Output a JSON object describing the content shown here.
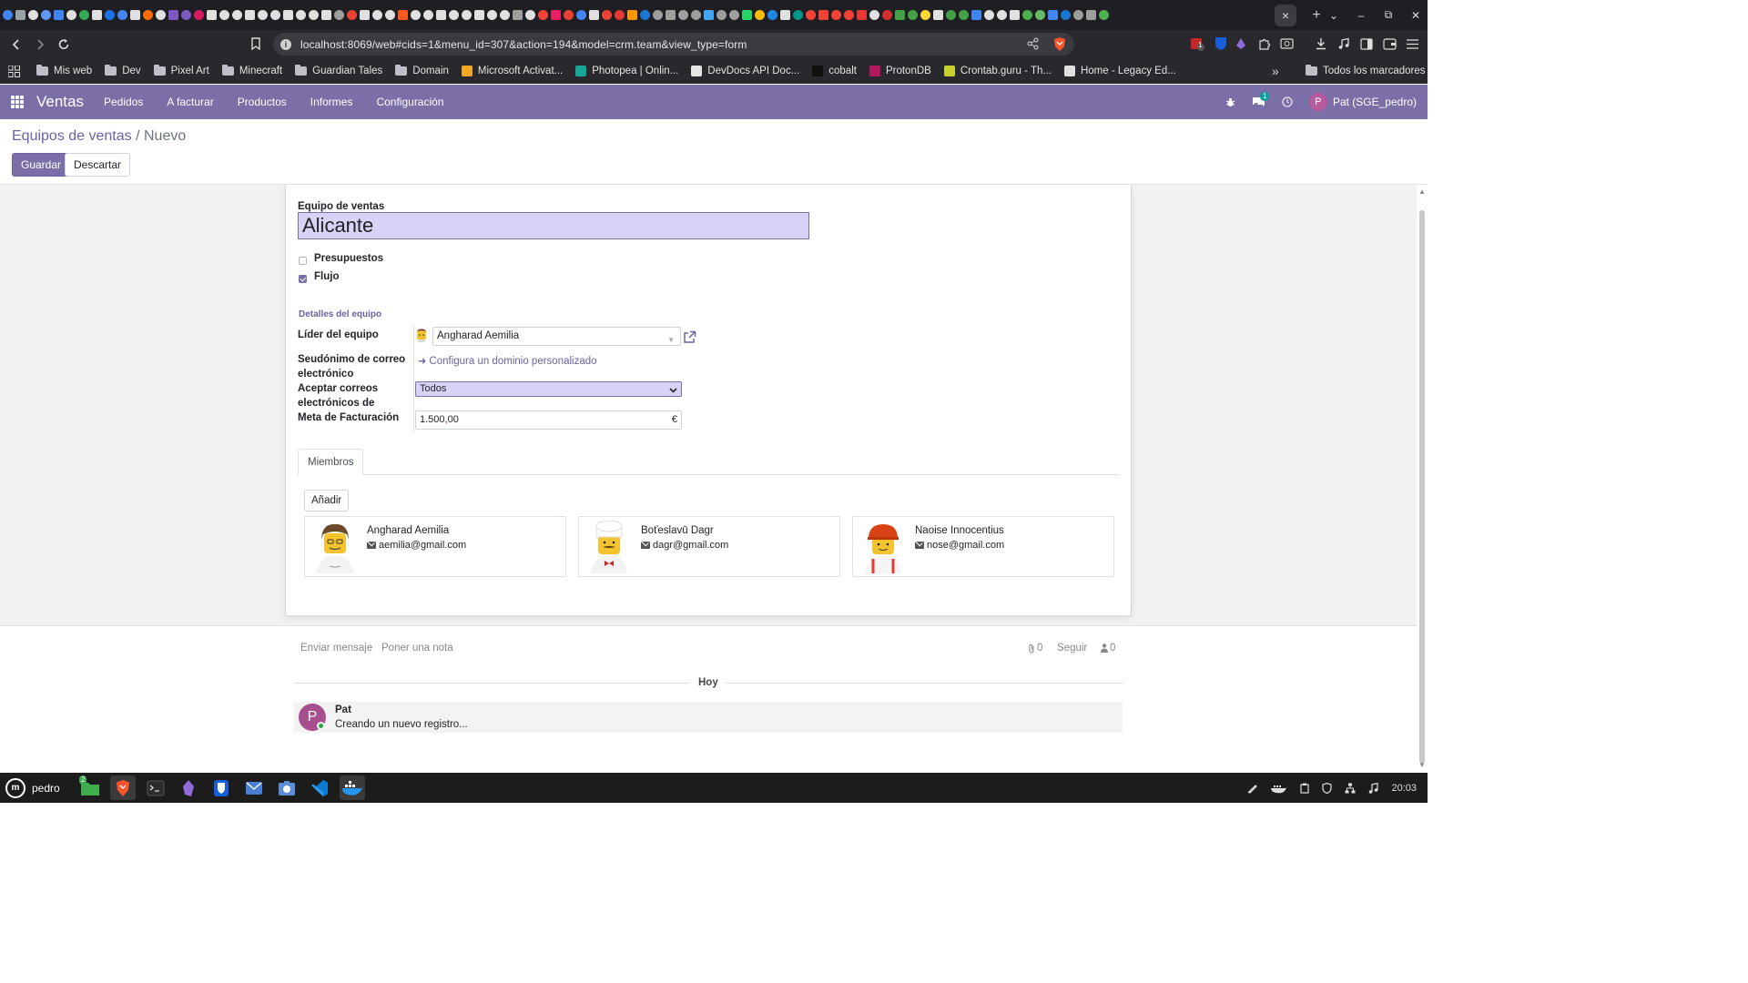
{
  "browser": {
    "url": "localhost:8069/web#cids=1&menu_id=307&action=194&model=crm.team&view_type=form",
    "close_tab_glyph": "×",
    "new_tab_glyph": "+",
    "tab_favicon_colors": [
      "#4285f4",
      "#9aa0a6",
      "#e0e0e0",
      "#5e97f6",
      "#4285f4",
      "#e0e0e0",
      "#34a853",
      "#e0e0e0",
      "#1a73e8",
      "#4285f4",
      "#e0e0e0",
      "#ff6d00",
      "#e0e0e0",
      "#7e57c2",
      "#7e57c2",
      "#d81b60",
      "#e0e0e0",
      "#e0e0e0",
      "#e0e0e0",
      "#e0e0e0",
      "#e0e0e0",
      "#e0e0e0",
      "#e0e0e0",
      "#e0e0e0",
      "#e0e0e0",
      "#e0e0e0",
      "#9e9e9e",
      "#ea4335",
      "#e0e0e0",
      "#e0e0e0",
      "#e0e0e0",
      "#ff5722",
      "#e0e0e0",
      "#e0e0e0",
      "#e0e0e0",
      "#e0e0e0",
      "#e0e0e0",
      "#e0e0e0",
      "#e0e0e0",
      "#e0e0e0",
      "#9e9e9e",
      "#e0e0e0",
      "#f44336",
      "#e91e63",
      "#ea4335",
      "#4285f4",
      "#e0e0e0",
      "#ea4335",
      "#e53935",
      "#ff9800",
      "#1976d2",
      "#9e9e9e",
      "#9e9e9e",
      "#9e9e9e",
      "#9e9e9e",
      "#42a5f5",
      "#9e9e9e",
      "#9e9e9e",
      "#25d366",
      "#fbbc04",
      "#1e88e5",
      "#e0e0e0",
      "#009688",
      "#f44336",
      "#f44336",
      "#f44336",
      "#f44336",
      "#e53935",
      "#e0e0e0",
      "#d32f2f",
      "#43a047",
      "#43a047",
      "#fdd835",
      "#e0e0e0",
      "#43a047",
      "#43a047",
      "#4285f4",
      "#e0e0e0",
      "#e0e0e0",
      "#e0e0e0",
      "#4caf50",
      "#66bb6a",
      "#4285f4",
      "#1976d2",
      "#9e9e9e",
      "#9e9e9e",
      "#4caf50"
    ],
    "bookmarks": [
      {
        "label": "Mis web",
        "icon": "folder"
      },
      {
        "label": "Dev",
        "icon": "folder"
      },
      {
        "label": "Pixel Art",
        "icon": "folder"
      },
      {
        "label": "Minecraft",
        "icon": "folder"
      },
      {
        "label": "Guardian Tales",
        "icon": "folder"
      },
      {
        "label": "Domain",
        "icon": "folder"
      },
      {
        "label": "Microsoft Activat...",
        "icon": "gear",
        "color": "#f5a623"
      },
      {
        "label": "Photopea | Onlin...",
        "icon": "photopea",
        "color": "#18a497"
      },
      {
        "label": "DevDocs API Doc...",
        "icon": "devdocs",
        "color": "#e6e6e6"
      },
      {
        "label": "cobalt",
        "icon": "cobalt",
        "color": "#111111"
      },
      {
        "label": "ProtonDB",
        "icon": "protondb",
        "color": "#b3185d"
      },
      {
        "label": "Crontab.guru - Th...",
        "icon": "crontab",
        "color": "#c6d22a"
      },
      {
        "label": "Home - Legacy Ed...",
        "icon": "shield",
        "color": "#e0e0e0"
      }
    ],
    "bookmarks_more": "»",
    "all_bookmarks": "Todos los marcadores",
    "ext_badge_count": "1"
  },
  "odoo": {
    "app_name": "Ventas",
    "menu": [
      "Pedidos",
      "A facturar",
      "Productos",
      "Informes",
      "Configuración"
    ],
    "chat_badge": "1",
    "user_initial": "P",
    "user_name": "Pat (SGE_pedro)",
    "accent": "#7c6fa8"
  },
  "control": {
    "breadcrumb_parent": "Equipos de ventas",
    "breadcrumb_sep": " / ",
    "breadcrumb_current": "Nuevo",
    "save": "Guardar",
    "discard": "Descartar"
  },
  "form": {
    "name_label": "Equipo de ventas",
    "name_value": "Alicante",
    "checkboxes": [
      {
        "label": "Presupuestos",
        "checked": false
      },
      {
        "label": "Flujo",
        "checked": true
      }
    ],
    "group_title": "Detalles del equipo",
    "leader_label": "Líder del equipo",
    "leader_value": "Angharad Aemilia",
    "alias_label": "Seudónimo de correo electrónico",
    "alias_link": "Configura un dominio personalizado",
    "accept_label": "Aceptar correos electrónicos de",
    "accept_value": "Todos",
    "goal_label": "Meta de Facturación",
    "goal_value": "1.500,00",
    "goal_currency": "€",
    "tab_members": "Miembros",
    "add_button": "Añadir",
    "members": [
      {
        "name": "Angharad Aemilia",
        "email": "aemilia@gmail.com",
        "figure": "brown-hair"
      },
      {
        "name": "Boťeslavū Dagr",
        "email": "dagr@gmail.com",
        "figure": "chef"
      },
      {
        "name": "Naoise Innocentius",
        "email": "nose@gmail.com",
        "figure": "red-helmet"
      }
    ]
  },
  "chatter": {
    "send_message": "Enviar mensaje",
    "log_note": "Poner una nota",
    "attachments_count": "0",
    "follow": "Seguir",
    "followers_count": "0",
    "today": "Hoy",
    "message": {
      "author_initial": "P",
      "author": "Pat",
      "body": "Creando un nuevo registro..."
    }
  },
  "taskbar": {
    "user": "pedro",
    "files_badge": "2",
    "clock": "20:03"
  }
}
